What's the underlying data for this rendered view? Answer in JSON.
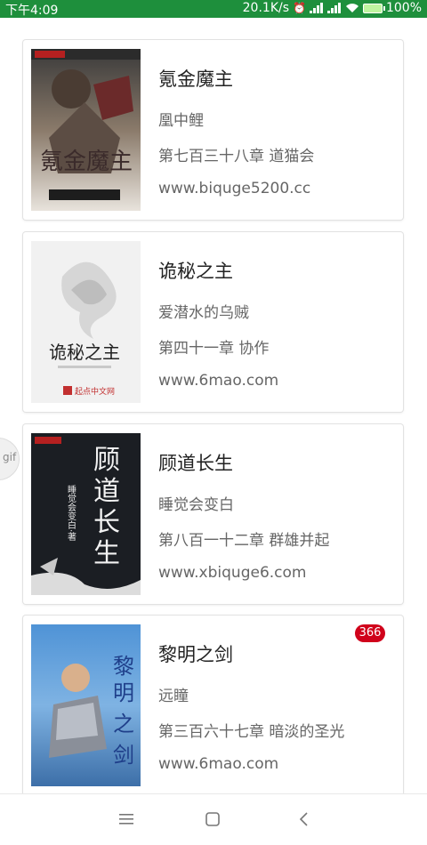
{
  "status_bar": {
    "time": "下午4:09",
    "network_speed": "20.1K/s",
    "battery": "100%"
  },
  "books": [
    {
      "title": "氪金魔主",
      "author": "凰中鲤",
      "latest_chapter": "第七百三十八章 道猫会",
      "source": "www.biquge5200.cc",
      "cover_title": "氪金魔主"
    },
    {
      "title": "诡秘之主",
      "author": "爱潜水的乌贼",
      "latest_chapter": "第四十一章 协作",
      "source": "www.6mao.com",
      "cover_title": "诡秘之主",
      "cover_publisher": "起点中文网"
    },
    {
      "title": "顾道长生",
      "author": "睡觉会变白",
      "latest_chapter": "第八百一十二章 群雄并起",
      "source": "www.xbiquge6.com",
      "cover_title": "顾道长生",
      "cover_author": "睡觉会变白·著"
    },
    {
      "title": "黎明之剑",
      "author": "远瞳",
      "latest_chapter": "第三百六十七章 暗淡的圣光",
      "source": "www.6mao.com",
      "badge": "366",
      "cover_title": "黎明之剑"
    }
  ],
  "floating_handle": {
    "label": "gif"
  },
  "icons": {
    "nav_menu": "menu-icon",
    "nav_home": "square-home-icon",
    "nav_back": "back-chevron-icon"
  },
  "colors": {
    "status_bar": "#1e8f3c",
    "badge": "#d0021b"
  }
}
